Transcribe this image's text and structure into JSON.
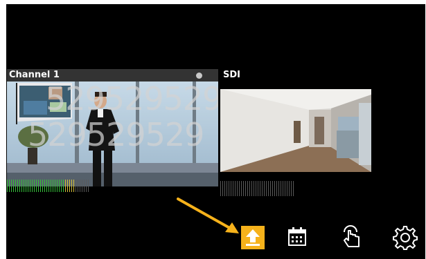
{
  "channels": [
    {
      "title": "Channel 1",
      "overlay_line1": "529529529",
      "overlay_line2": "529529529",
      "status_dot_color": "#c8c8c8"
    },
    {
      "title": "SDI"
    }
  ],
  "toolbar": {
    "items": [
      {
        "icon": "upload-icon",
        "active": true,
        "accent": "#f6b21b"
      },
      {
        "icon": "calendar-icon",
        "active": false
      },
      {
        "icon": "touch-icon",
        "active": false
      },
      {
        "icon": "gear-icon",
        "active": false
      }
    ]
  },
  "annotation": {
    "arrow_color": "#f6b21b"
  },
  "colors": {
    "meter_green": "#36c23a",
    "meter_yellow": "#d8c23a",
    "meter_idle": "#5a5a5a"
  }
}
